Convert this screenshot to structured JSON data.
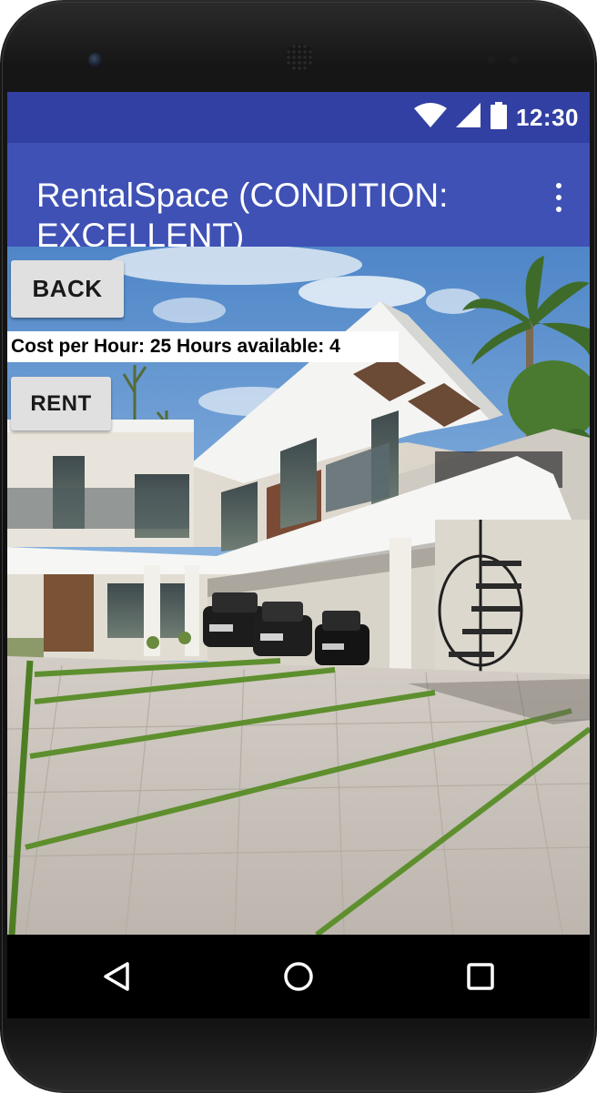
{
  "status_bar": {
    "time": "12:30",
    "icons": [
      "wifi-icon",
      "cellular-signal-icon",
      "battery-icon"
    ]
  },
  "app_bar": {
    "title": "RentalSpace (CONDITION: EXCELLENT)",
    "menu_icon": "more-vert-icon"
  },
  "main": {
    "back_label": "BACK",
    "info_text": "Cost per Hour: 25 Hours available: 4",
    "rent_label": "RENT"
  },
  "nav_bar": {
    "icons": [
      "back-triangle-icon",
      "home-circle-icon",
      "recents-square-icon"
    ]
  },
  "colors": {
    "status_bar": "#3140a2",
    "app_bar": "#3f51b5",
    "button": "#e0e0e0"
  }
}
